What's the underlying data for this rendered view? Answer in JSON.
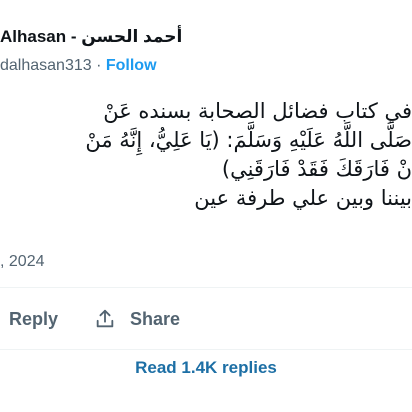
{
  "author": {
    "name_latin": "Alhasan",
    "separator": " - ",
    "name_arabic": "أحمد الحسن",
    "handle": "dalhasan313",
    "handle_separator": " · ",
    "follow_label": "Follow"
  },
  "tweet": {
    "lines": [
      "في كتاب فضائل الصحابة بسنده عَنْ",
      "صَلَّى اللَّهُ عَلَيْهِ وَسَلَّمَ: (يَا عَلِيُّ، إِنَّهُ مَنْ",
      "نْ فَارَقَكَ فَقَدْ فَارَقَنِي)",
      "بيننا وبين علي طرفة عين"
    ]
  },
  "meta": {
    "date": ", 2024"
  },
  "actions": {
    "reply_label": "Reply",
    "share_label": "Share",
    "share_icon": "share-icon"
  },
  "footer": {
    "read_replies_label": "Read 1.4K replies"
  },
  "colors": {
    "link": "#1d9bf0",
    "muted": "#536471",
    "replies_link": "#1d6fa5",
    "divider": "#eff3f4"
  }
}
